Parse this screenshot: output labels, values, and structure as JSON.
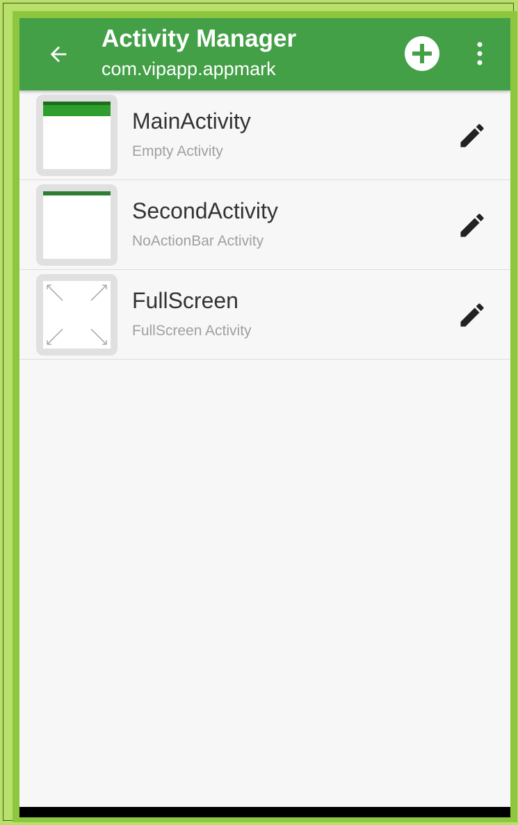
{
  "appbar": {
    "title": "Activity Manager",
    "subtitle": "com.vipapp.appmark",
    "back_icon": "arrow-left-icon",
    "add_icon": "plus-circle-icon",
    "more_icon": "more-vertical-icon",
    "color": "#43a047"
  },
  "activities": [
    {
      "name": "MainActivity",
      "type": "Empty Activity",
      "preview": "action-bar"
    },
    {
      "name": "SecondActivity",
      "type": "NoActionBar Activity",
      "preview": "no-action-bar"
    },
    {
      "name": "FullScreen",
      "type": "FullScreen Activity",
      "preview": "fullscreen"
    }
  ],
  "row_action_icon": "pencil-icon",
  "colors": {
    "frame": "#8dc63f",
    "background": "#f7f7f7",
    "title_text": "#333333",
    "subtitle_text": "#a0a0a0"
  }
}
